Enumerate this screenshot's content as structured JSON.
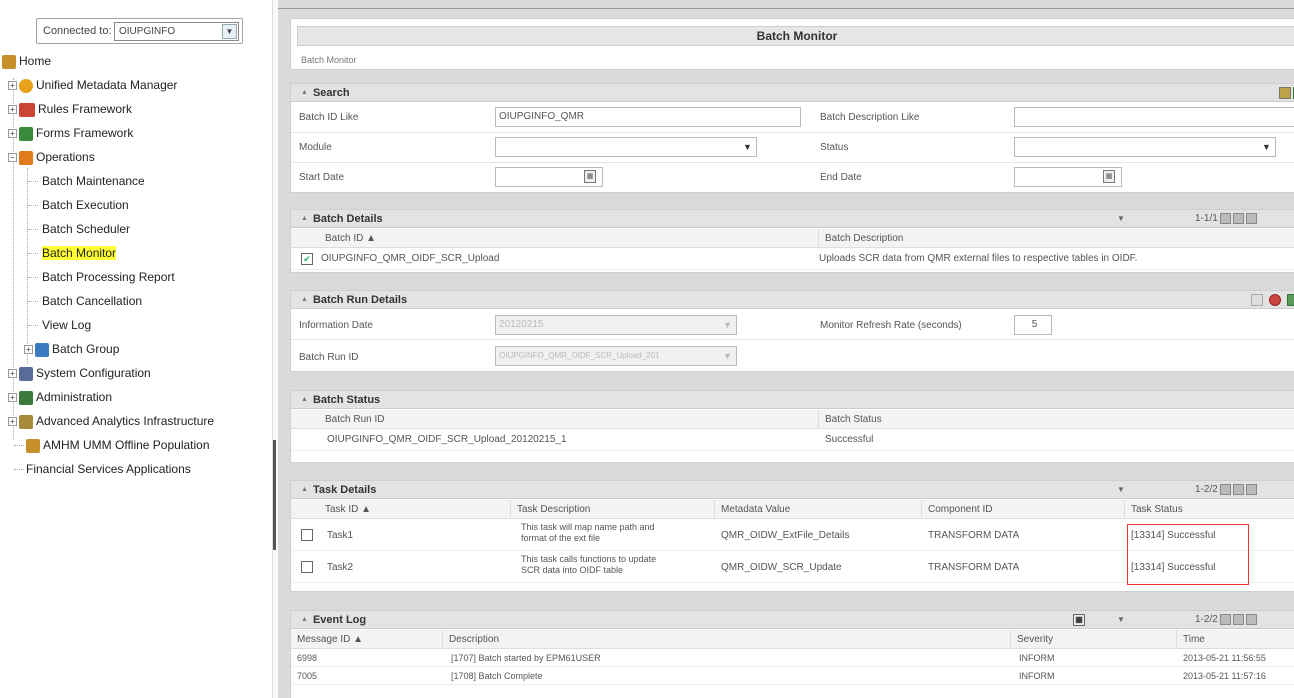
{
  "connection": {
    "label": "Connected to:",
    "value": "OIUPGINFO"
  },
  "tree": {
    "home": "Home",
    "umm": "Unified Metadata Manager",
    "rules": "Rules Framework",
    "forms": "Forms Framework",
    "operations": "Operations",
    "ops_items": [
      "Batch Maintenance",
      "Batch Execution",
      "Batch Scheduler",
      "Batch Monitor",
      "Batch Processing Report",
      "Batch Cancellation",
      "View Log"
    ],
    "batch_group": "Batch Group",
    "syscfg": "System Configuration",
    "admin": "Administration",
    "aai": "Advanced Analytics Infrastructure",
    "amhm": "AMHM UMM Offline Population",
    "fsa": "Financial Services Applications"
  },
  "page": {
    "title": "Batch Monitor",
    "breadcrumb": "Batch Monitor"
  },
  "search": {
    "title": "Search",
    "batch_id_label": "Batch ID Like",
    "batch_id_value": "OIUPGINFO_QMR",
    "batch_desc_label": "Batch Description Like",
    "batch_desc_value": "",
    "module_label": "Module",
    "module_value": "",
    "status_label": "Status",
    "status_value": "",
    "start_label": "Start Date",
    "start_value": "",
    "end_label": "End Date",
    "end_value": ""
  },
  "batch_details": {
    "title": "Batch Details",
    "pagination": "1-1/1",
    "columns": [
      "Batch ID ▲",
      "Batch Description"
    ],
    "rows": [
      {
        "id": "OIUPGINFO_QMR_OIDF_SCR_Upload",
        "desc": "Uploads SCR data from QMR external files to respective tables in OIDF."
      }
    ]
  },
  "batch_run": {
    "title": "Batch Run Details",
    "info_date_label": "Information Date",
    "info_date_value": "20120215",
    "refresh_label": "Monitor Refresh Rate (seconds)",
    "refresh_value": "5",
    "run_id_label": "Batch Run ID",
    "run_id_value": "OIUPGINFO_QMR_OIDF_SCR_Upload_201"
  },
  "batch_status": {
    "title": "Batch Status",
    "columns": [
      "Batch Run ID",
      "Batch Status"
    ],
    "rows": [
      {
        "run_id": "OIUPGINFO_QMR_OIDF_SCR_Upload_20120215_1",
        "status": "Successful"
      }
    ]
  },
  "task_details": {
    "title": "Task Details",
    "pagination": "1-2/2",
    "columns": [
      "Task ID ▲",
      "Task Description",
      "Metadata Value",
      "Component ID",
      "Task Status"
    ],
    "rows": [
      {
        "id": "Task1",
        "desc1": "This task will map name path and",
        "desc2": "format of the ext file",
        "meta": "QMR_OIDW_ExtFile_Details",
        "comp": "TRANSFORM DATA",
        "status": "[13314] Successful"
      },
      {
        "id": "Task2",
        "desc1": "This task calls functions to update",
        "desc2": "SCR data into OIDF table",
        "meta": "QMR_OIDW_SCR_Update",
        "comp": "TRANSFORM DATA",
        "status": "[13314] Successful"
      }
    ]
  },
  "event_log": {
    "title": "Event Log",
    "pagination": "1-2/2",
    "columns": [
      "Message ID ▲",
      "Description",
      "Severity",
      "Time"
    ],
    "rows": [
      {
        "id": "6998",
        "desc": "[1707] Batch started by EPM61USER",
        "sev": "INFORM",
        "time": "2013-05-21 11:56:55"
      },
      {
        "id": "7005",
        "desc": "[1708] Batch Complete",
        "sev": "INFORM",
        "time": "2013-05-21 11:57:16"
      }
    ]
  }
}
